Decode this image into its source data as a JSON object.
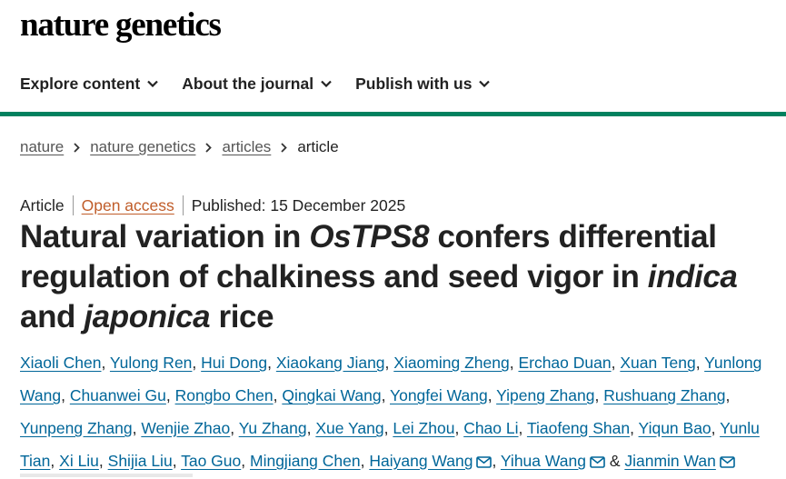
{
  "header": {
    "logo_text": "nature genetics"
  },
  "nav": {
    "items": [
      {
        "label": "Explore content",
        "icon": "chevron-down-icon"
      },
      {
        "label": "About the journal",
        "icon": "chevron-down-icon"
      },
      {
        "label": "Publish with us",
        "icon": "chevron-down-icon"
      }
    ]
  },
  "colors": {
    "brand_bar": "#00815f",
    "open_access": "#c05d2a",
    "author_link": "#006699"
  },
  "breadcrumb": {
    "items": [
      {
        "label": "nature"
      },
      {
        "label": "nature genetics"
      },
      {
        "label": "articles"
      },
      {
        "label": "article"
      }
    ]
  },
  "article": {
    "type": "Article",
    "access": "Open access",
    "published": "Published: 15 December 2025",
    "title": {
      "part1": "Natural variation in ",
      "gene": "OsTPS8",
      "part2": " confers differential regulation of chalkiness and seed vigor in ",
      "italic1": "indica",
      "part3": " and ",
      "italic2": "japonica",
      "part4": " rice"
    },
    "authors": [
      {
        "name": "Xiaoli Chen"
      },
      {
        "name": "Yulong Ren"
      },
      {
        "name": "Hui Dong"
      },
      {
        "name": "Xiaokang Jiang"
      },
      {
        "name": "Xiaoming Zheng"
      },
      {
        "name": "Erchao Duan"
      },
      {
        "name": "Xuan Teng"
      },
      {
        "name": "Yunlong Wang"
      },
      {
        "name": "Chuanwei Gu"
      },
      {
        "name": "Rongbo Chen"
      },
      {
        "name": "Qingkai Wang"
      },
      {
        "name": "Yongfei Wang"
      },
      {
        "name": "Yipeng Zhang"
      },
      {
        "name": "Rushuang Zhang"
      },
      {
        "name": "Yunpeng Zhang"
      },
      {
        "name": "Wenjie Zhao"
      },
      {
        "name": "Yu Zhang"
      },
      {
        "name": "Xue Yang"
      },
      {
        "name": "Lei Zhou"
      },
      {
        "name": "Chao Li"
      },
      {
        "name": "Tiaofeng Shan"
      },
      {
        "name": "Yiqun Bao"
      },
      {
        "name": "Yunlu Tian"
      },
      {
        "name": "Xi Liu"
      },
      {
        "name": "Shijia Liu"
      },
      {
        "name": "Tao Guo"
      },
      {
        "name": "Mingjiang Chen"
      },
      {
        "name": "Haiyang Wang",
        "corresponding": true
      },
      {
        "name": "Yihua Wang",
        "corresponding": true
      },
      {
        "name": "Jianmin Wan",
        "corresponding": true
      }
    ],
    "author_separator": ", ",
    "author_last_joiner": " & "
  }
}
